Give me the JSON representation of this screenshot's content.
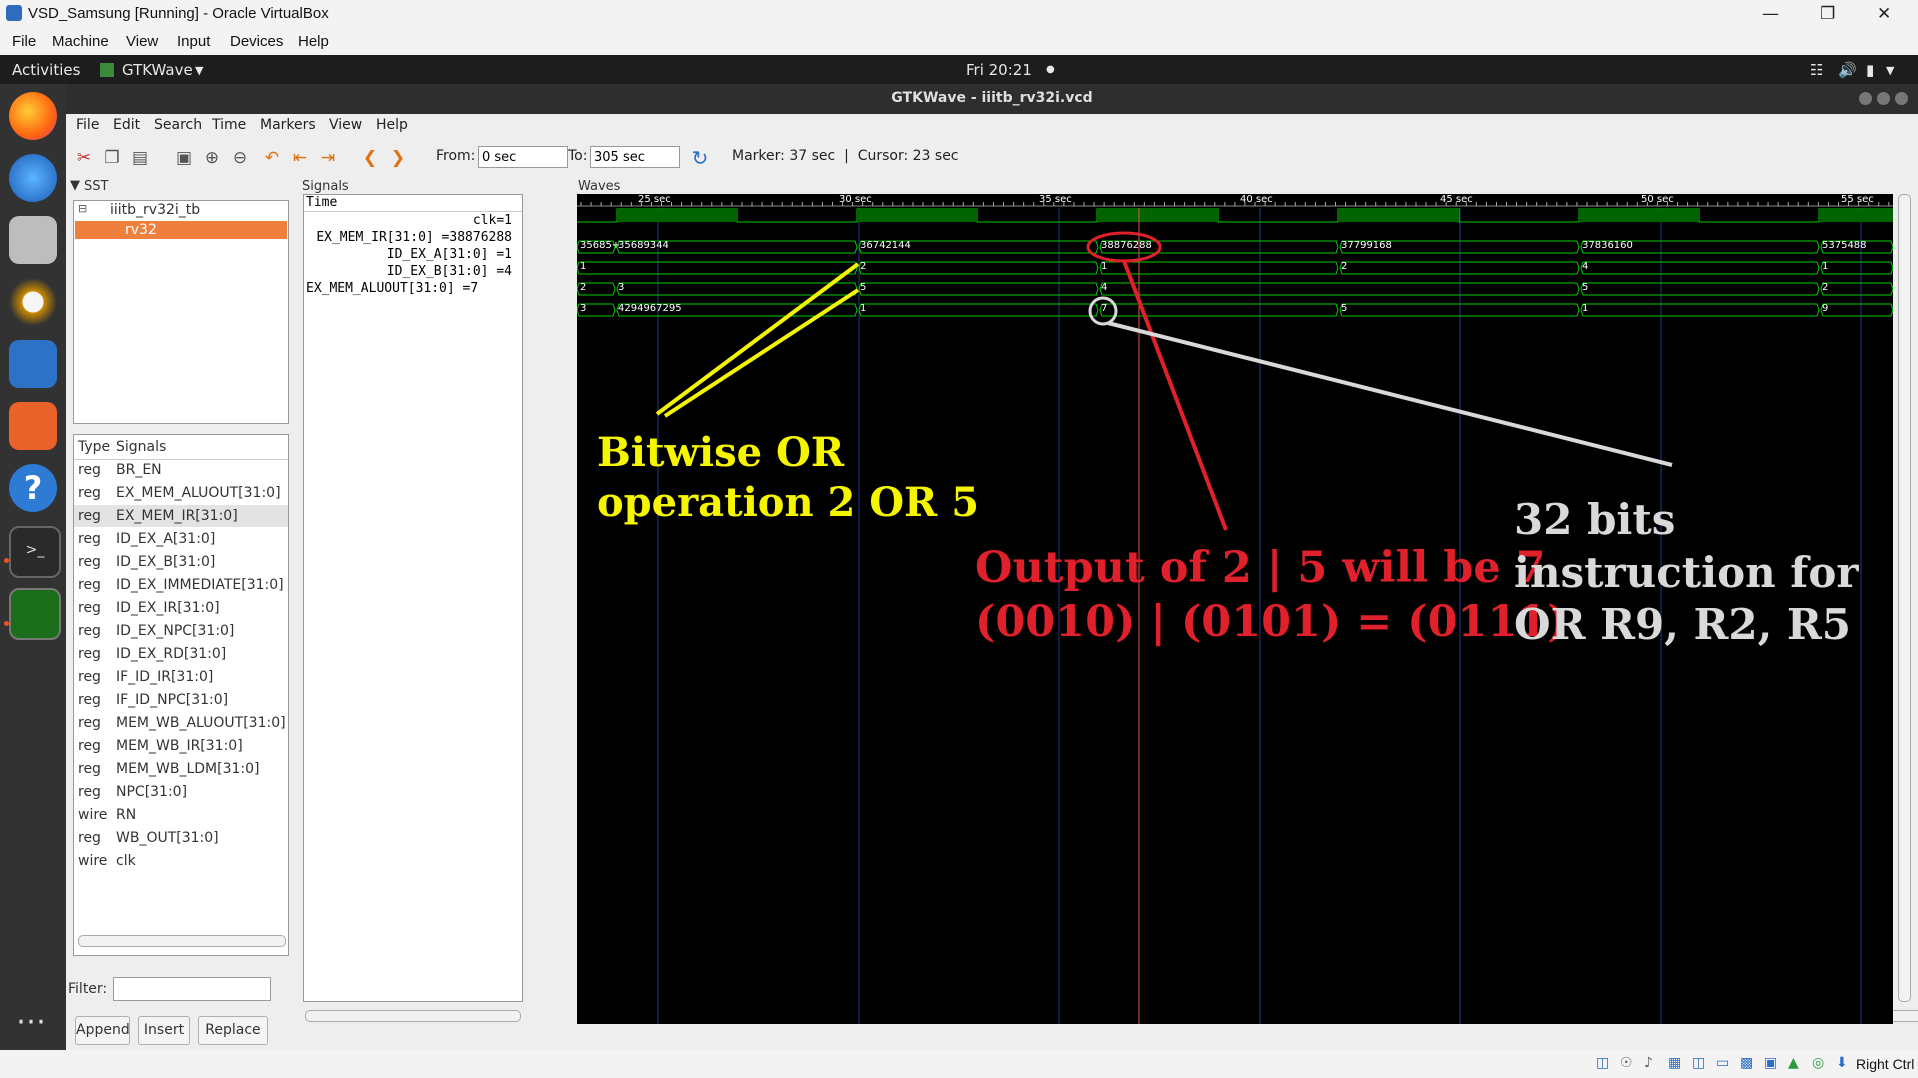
{
  "vbox": {
    "title": "VSD_Samsung [Running] - Oracle VirtualBox",
    "menu": [
      "File",
      "Machine",
      "View",
      "Input",
      "Devices",
      "Help"
    ],
    "host_key": "Right Ctrl"
  },
  "topbar": {
    "activities": "Activities",
    "app": "GTKWave",
    "clock": "Fri 20:21"
  },
  "gtkwave": {
    "title": "GTKWave - iiitb_rv32i.vcd",
    "menu": [
      "File",
      "Edit",
      "Search",
      "Time",
      "Markers",
      "View",
      "Help"
    ],
    "from_label": "From:",
    "from_value": "0 sec",
    "to_label": "To:",
    "to_value": "305 sec",
    "marker_text": "Marker: 37 sec  |  Cursor: 23 sec",
    "sst_label": "SST",
    "tree": [
      "iiitb_rv32i_tb",
      "rv32"
    ],
    "type_header": "Type",
    "signals_header": "Signals",
    "signal_list": [
      {
        "type": "reg",
        "name": "BR_EN"
      },
      {
        "type": "reg",
        "name": "EX_MEM_ALUOUT[31:0]"
      },
      {
        "type": "reg",
        "name": "EX_MEM_IR[31:0]"
      },
      {
        "type": "reg",
        "name": "ID_EX_A[31:0]"
      },
      {
        "type": "reg",
        "name": "ID_EX_B[31:0]"
      },
      {
        "type": "reg",
        "name": "ID_EX_IMMEDIATE[31:0]"
      },
      {
        "type": "reg",
        "name": "ID_EX_IR[31:0]"
      },
      {
        "type": "reg",
        "name": "ID_EX_NPC[31:0]"
      },
      {
        "type": "reg",
        "name": "ID_EX_RD[31:0]"
      },
      {
        "type": "reg",
        "name": "IF_ID_IR[31:0]"
      },
      {
        "type": "reg",
        "name": "IF_ID_NPC[31:0]"
      },
      {
        "type": "reg",
        "name": "MEM_WB_ALUOUT[31:0]"
      },
      {
        "type": "reg",
        "name": "MEM_WB_IR[31:0]"
      },
      {
        "type": "reg",
        "name": "MEM_WB_LDM[31:0]"
      },
      {
        "type": "reg",
        "name": "NPC[31:0]"
      },
      {
        "type": "wire",
        "name": "RN"
      },
      {
        "type": "reg",
        "name": "WB_OUT[31:0]"
      },
      {
        "type": "wire",
        "name": "clk"
      }
    ],
    "filter_label": "Filter:",
    "buttons": [
      "Append",
      "Insert",
      "Replace"
    ],
    "signals_panel_label": "Signals",
    "waves_panel_label": "Waves",
    "time_header": "Time",
    "wave_names": [
      "clk=1",
      "EX_MEM_IR[31:0] =38876288",
      "ID_EX_A[31:0] =1",
      "ID_EX_B[31:0] =4",
      "EX_MEM_ALUOUT[31:0] =7"
    ],
    "time_ticks": [
      "25 sec",
      "30 sec",
      "35 sec",
      "40 sec",
      "45 sec",
      "50 sec",
      "55 sec"
    ],
    "bus_values": {
      "ir": [
        "35685+",
        "35689344",
        "36742144",
        "38876288",
        "37799168",
        "37836160",
        "5375488"
      ],
      "a": [
        "1",
        "2",
        "1",
        "2",
        "4",
        "1"
      ],
      "b": [
        "2",
        "3",
        "5",
        "4",
        "5",
        "2"
      ],
      "aluout": [
        "3",
        "4294967295",
        "1",
        "7",
        "5",
        "1",
        "9"
      ]
    }
  },
  "annotations": {
    "yellow": [
      "Bitwise OR",
      "operation 2 OR 5"
    ],
    "red": [
      "Output of 2 | 5 will be 7",
      "(0010) | (0101) = (0111)"
    ],
    "gray": [
      "32 bits",
      "instruction for",
      "OR R9, R2, R5"
    ],
    "colors": {
      "yellow": "#f5f500",
      "red": "#e0202a",
      "gray": "#d9d9d9",
      "wave_green": "#00cc00"
    }
  }
}
